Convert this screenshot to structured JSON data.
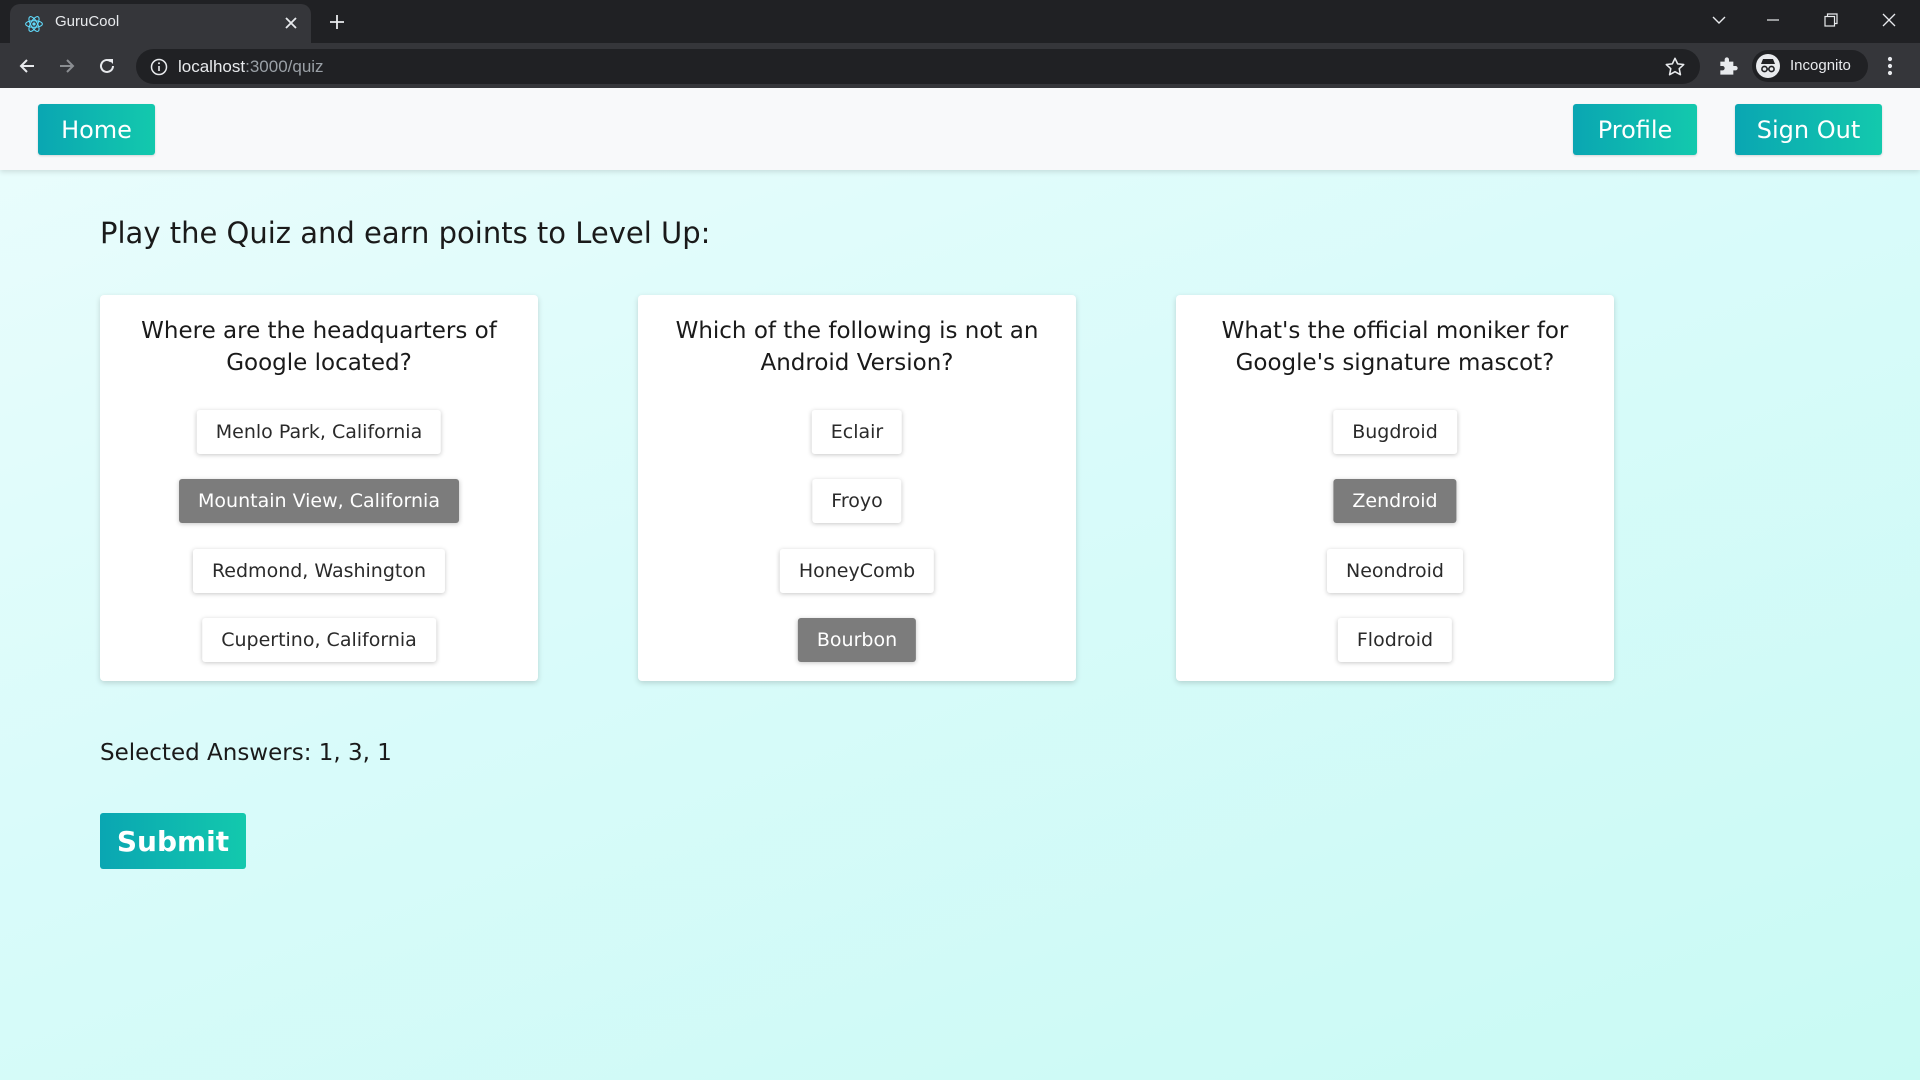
{
  "browser": {
    "tab_title": "GuruCool",
    "url_host": "localhost",
    "url_rest": ":3000/quiz",
    "profile_label": "Incognito"
  },
  "navbar": {
    "home_label": "Home",
    "profile_label": "Profile",
    "signout_label": "Sign Out"
  },
  "quiz": {
    "heading": "Play the Quiz and earn points to Level Up:",
    "questions": [
      {
        "question": "Where are the headquarters of Google located?",
        "options": [
          "Menlo Park, California",
          "Mountain View, California",
          "Redmond, Washington",
          "Cupertino, California"
        ],
        "selected_index": 1
      },
      {
        "question": "Which of the following is not an Android Version?",
        "options": [
          "Eclair",
          "Froyo",
          "HoneyComb",
          "Bourbon"
        ],
        "selected_index": 3
      },
      {
        "question": "What's the official moniker for Google's signature mascot?",
        "options": [
          "Bugdroid",
          "Zendroid",
          "Neondroid",
          "Flodroid"
        ],
        "selected_index": 1
      }
    ],
    "selected_answers": "Selected Answers: 1, 3, 1",
    "submit_label": "Submit"
  },
  "colors": {
    "accent_start": "#0aa6b2",
    "accent_end": "#13c9ad",
    "selected_option": "#7c7c7c",
    "page_bg": "#d9fbfa"
  }
}
